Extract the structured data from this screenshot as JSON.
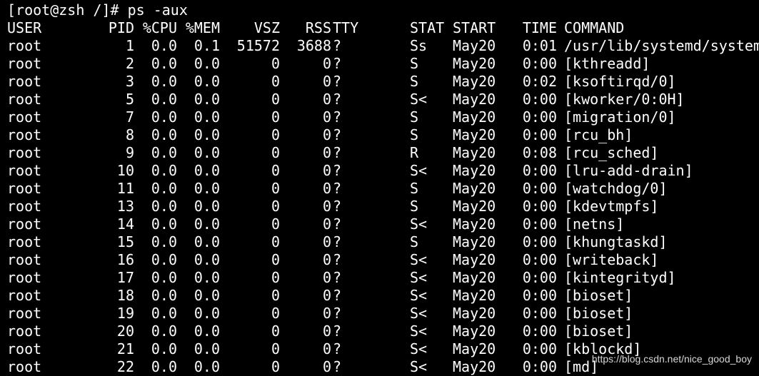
{
  "prompt": "[root@zsh /]# ps -aux",
  "headers": {
    "user": "USER",
    "pid": "PID",
    "cpu": "%CPU",
    "mem": "%MEM",
    "vsz": "VSZ",
    "rss": "RSS",
    "tty": "TTY",
    "stat": "STAT",
    "start": "START",
    "time": "TIME",
    "command": "COMMAND"
  },
  "rows": [
    {
      "user": "root",
      "pid": "1",
      "cpu": "0.0",
      "mem": "0.1",
      "vsz": "51572",
      "rss": "3688",
      "tty": "?",
      "stat": "Ss",
      "start": "May20",
      "time": "0:01",
      "command": "/usr/lib/systemd/systemd"
    },
    {
      "user": "root",
      "pid": "2",
      "cpu": "0.0",
      "mem": "0.0",
      "vsz": "0",
      "rss": "0",
      "tty": "?",
      "stat": "S",
      "start": "May20",
      "time": "0:00",
      "command": "[kthreadd]"
    },
    {
      "user": "root",
      "pid": "3",
      "cpu": "0.0",
      "mem": "0.0",
      "vsz": "0",
      "rss": "0",
      "tty": "?",
      "stat": "S",
      "start": "May20",
      "time": "0:02",
      "command": "[ksoftirqd/0]"
    },
    {
      "user": "root",
      "pid": "5",
      "cpu": "0.0",
      "mem": "0.0",
      "vsz": "0",
      "rss": "0",
      "tty": "?",
      "stat": "S<",
      "start": "May20",
      "time": "0:00",
      "command": "[kworker/0:0H]"
    },
    {
      "user": "root",
      "pid": "7",
      "cpu": "0.0",
      "mem": "0.0",
      "vsz": "0",
      "rss": "0",
      "tty": "?",
      "stat": "S",
      "start": "May20",
      "time": "0:00",
      "command": "[migration/0]"
    },
    {
      "user": "root",
      "pid": "8",
      "cpu": "0.0",
      "mem": "0.0",
      "vsz": "0",
      "rss": "0",
      "tty": "?",
      "stat": "S",
      "start": "May20",
      "time": "0:00",
      "command": "[rcu_bh]"
    },
    {
      "user": "root",
      "pid": "9",
      "cpu": "0.0",
      "mem": "0.0",
      "vsz": "0",
      "rss": "0",
      "tty": "?",
      "stat": "R",
      "start": "May20",
      "time": "0:08",
      "command": "[rcu_sched]"
    },
    {
      "user": "root",
      "pid": "10",
      "cpu": "0.0",
      "mem": "0.0",
      "vsz": "0",
      "rss": "0",
      "tty": "?",
      "stat": "S<",
      "start": "May20",
      "time": "0:00",
      "command": "[lru-add-drain]"
    },
    {
      "user": "root",
      "pid": "11",
      "cpu": "0.0",
      "mem": "0.0",
      "vsz": "0",
      "rss": "0",
      "tty": "?",
      "stat": "S",
      "start": "May20",
      "time": "0:00",
      "command": "[watchdog/0]"
    },
    {
      "user": "root",
      "pid": "13",
      "cpu": "0.0",
      "mem": "0.0",
      "vsz": "0",
      "rss": "0",
      "tty": "?",
      "stat": "S",
      "start": "May20",
      "time": "0:00",
      "command": "[kdevtmpfs]"
    },
    {
      "user": "root",
      "pid": "14",
      "cpu": "0.0",
      "mem": "0.0",
      "vsz": "0",
      "rss": "0",
      "tty": "?",
      "stat": "S<",
      "start": "May20",
      "time": "0:00",
      "command": "[netns]"
    },
    {
      "user": "root",
      "pid": "15",
      "cpu": "0.0",
      "mem": "0.0",
      "vsz": "0",
      "rss": "0",
      "tty": "?",
      "stat": "S",
      "start": "May20",
      "time": "0:00",
      "command": "[khungtaskd]"
    },
    {
      "user": "root",
      "pid": "16",
      "cpu": "0.0",
      "mem": "0.0",
      "vsz": "0",
      "rss": "0",
      "tty": "?",
      "stat": "S<",
      "start": "May20",
      "time": "0:00",
      "command": "[writeback]"
    },
    {
      "user": "root",
      "pid": "17",
      "cpu": "0.0",
      "mem": "0.0",
      "vsz": "0",
      "rss": "0",
      "tty": "?",
      "stat": "S<",
      "start": "May20",
      "time": "0:00",
      "command": "[kintegrityd]"
    },
    {
      "user": "root",
      "pid": "18",
      "cpu": "0.0",
      "mem": "0.0",
      "vsz": "0",
      "rss": "0",
      "tty": "?",
      "stat": "S<",
      "start": "May20",
      "time": "0:00",
      "command": "[bioset]"
    },
    {
      "user": "root",
      "pid": "19",
      "cpu": "0.0",
      "mem": "0.0",
      "vsz": "0",
      "rss": "0",
      "tty": "?",
      "stat": "S<",
      "start": "May20",
      "time": "0:00",
      "command": "[bioset]"
    },
    {
      "user": "root",
      "pid": "20",
      "cpu": "0.0",
      "mem": "0.0",
      "vsz": "0",
      "rss": "0",
      "tty": "?",
      "stat": "S<",
      "start": "May20",
      "time": "0:00",
      "command": "[bioset]"
    },
    {
      "user": "root",
      "pid": "21",
      "cpu": "0.0",
      "mem": "0.0",
      "vsz": "0",
      "rss": "0",
      "tty": "?",
      "stat": "S<",
      "start": "May20",
      "time": "0:00",
      "command": "[kblockd]"
    },
    {
      "user": "root",
      "pid": "22",
      "cpu": "0.0",
      "mem": "0.0",
      "vsz": "0",
      "rss": "0",
      "tty": "?",
      "stat": "S<",
      "start": "May20",
      "time": "0:00",
      "command": "[md]"
    }
  ],
  "watermark": "https://blog.csdn.net/nice_good_boy",
  "colors": {
    "background": "#000000",
    "text": "#ffffff"
  }
}
